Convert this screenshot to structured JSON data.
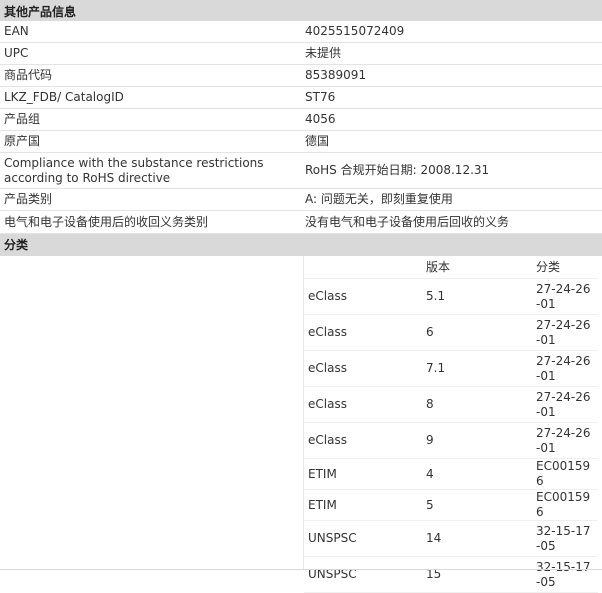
{
  "other_info": {
    "title": "其他产品信息",
    "rows": [
      {
        "label": "EAN",
        "value": "4025515072409"
      },
      {
        "label": "UPC",
        "value": "未提供"
      },
      {
        "label": "商品代码",
        "value": "85389091"
      },
      {
        "label": "LKZ_FDB/ CatalogID",
        "value": "ST76"
      },
      {
        "label": "产品组",
        "value": "4056"
      },
      {
        "label": "原产国",
        "value": "德国"
      },
      {
        "label": "Compliance with the substance restrictions according to RoHS directive",
        "value": "RoHS 合规开始日期: 2008.12.31"
      },
      {
        "label": "产品类别",
        "value": "A: 问题无关，即刻重复使用"
      },
      {
        "label": "电气和电子设备使用后的收回义务类别",
        "value": "没有电气和电子设备使用后回收的义务"
      }
    ]
  },
  "classification": {
    "title": "分类",
    "headers": {
      "system": "",
      "version": "版本",
      "class": "分类"
    },
    "rows": [
      {
        "system": "eClass",
        "version": "5.1",
        "class": "27-24-26-01"
      },
      {
        "system": "eClass",
        "version": "6",
        "class": "27-24-26-01"
      },
      {
        "system": "eClass",
        "version": "7.1",
        "class": "27-24-26-01"
      },
      {
        "system": "eClass",
        "version": "8",
        "class": "27-24-26-01"
      },
      {
        "system": "eClass",
        "version": "9",
        "class": "27-24-26-01"
      },
      {
        "system": "ETIM",
        "version": "4",
        "class": "EC001596"
      },
      {
        "system": "ETIM",
        "version": "5",
        "class": "EC001596"
      },
      {
        "system": "UNSPSC",
        "version": "14",
        "class": "32-15-17-05"
      },
      {
        "system": "UNSPSC",
        "version": "15",
        "class": "32-15-17-05"
      }
    ]
  }
}
